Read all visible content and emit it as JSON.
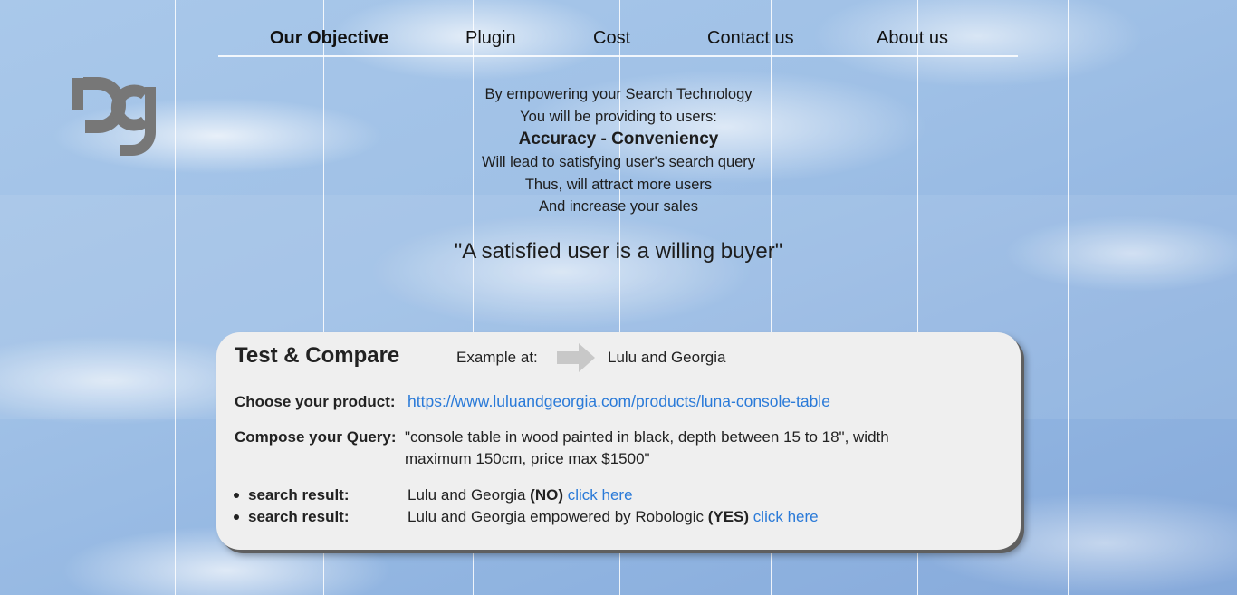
{
  "nav": {
    "items": [
      {
        "label": "Our Objective",
        "active": true
      },
      {
        "label": "Plugin",
        "active": false
      },
      {
        "label": "Cost",
        "active": false
      },
      {
        "label": "Contact us",
        "active": false
      },
      {
        "label": "About us",
        "active": false
      }
    ]
  },
  "logo": {
    "icon": "robologic-logo-icon",
    "color": "#777777"
  },
  "objective": {
    "lines": [
      "By empowering your Search Technology",
      "You will be providing to users:",
      "Accuracy - Conveniency",
      "Will lead to satisfying user's search query",
      "Thus, will attract more users",
      "And increase your sales"
    ],
    "quote": "\"A satisfied user is a willing buyer\""
  },
  "card": {
    "title": "Test & Compare",
    "example_label": "Example at:",
    "example_icon": "arrow-right-icon",
    "example_site": "Lulu and Georgia",
    "product_label": "Choose your product:",
    "product_url": "https://www.luluandgeorgia.com/products/luna-console-table",
    "query_label": "Compose your Query:",
    "query_text": "\"console table in wood painted in black, depth between 15 to 18\", width maximum 150cm, price max $1500\"",
    "results": [
      {
        "label": "search result:",
        "text": "Lulu and Georgia",
        "verdict": "(NO)",
        "link": "click here"
      },
      {
        "label": "search result:",
        "text": "Lulu and Georgia empowered by Robologic",
        "verdict": "(YES)",
        "link": "click here"
      }
    ]
  },
  "colors": {
    "link": "#2a7ad8",
    "card_bg": "#efefef",
    "logo": "#777777"
  }
}
